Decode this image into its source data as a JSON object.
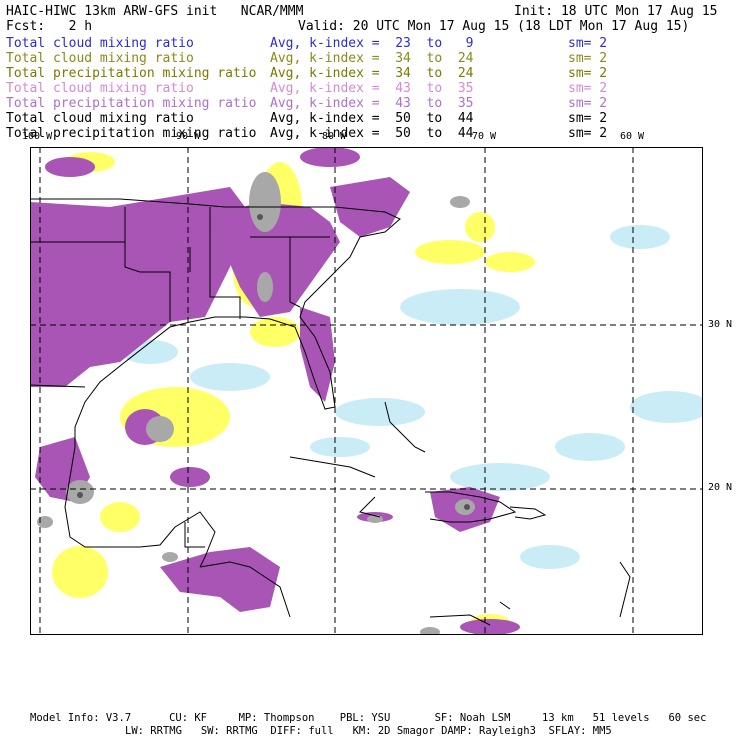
{
  "header": {
    "title": "HAIC-HIWC 13km ARW-GFS init   NCAR/MMM",
    "init": "Init: 18 UTC Mon 17 Aug 15",
    "fcst": "Fcst:   2 h",
    "valid": "Valid: 20 UTC Mon 17 Aug 15 (18 LDT Mon 17 Aug 15)"
  },
  "legend": [
    {
      "field": "Total cloud mixing ratio",
      "index": "Avg, k-index =  23  to   9",
      "sm": "sm= 2",
      "color": "#2c2ccc"
    },
    {
      "field": "Total cloud mixing ratio",
      "index": "Avg, k-index =  34  to  24",
      "sm": "sm= 2",
      "color": "#8a8a1a"
    },
    {
      "field": "Total precipitation mixing ratio",
      "index": "Avg, k-index =  34  to  24",
      "sm": "sm= 2",
      "color": "#7a7a00"
    },
    {
      "field": "Total cloud mixing ratio",
      "index": "Avg, k-index =  43  to  35",
      "sm": "sm= 2",
      "color": "#d68ad6"
    },
    {
      "field": "Total precipitation mixing ratio",
      "index": "Avg, k-index =  43  to  35",
      "sm": "sm= 2",
      "color": "#b070c8"
    },
    {
      "field": "Total cloud mixing ratio",
      "index": "Avg, k-index =  50  to  44",
      "sm": "sm= 2",
      "color": "#000000"
    },
    {
      "field": "Total precipitation mixing ratio",
      "index": "Avg, k-index =  50  to  44",
      "sm": "sm= 2",
      "color": "#000000"
    }
  ],
  "map": {
    "lon_labels": [
      "100 W",
      "90 W",
      "80 W",
      "70 W",
      "60 W"
    ],
    "lat_labels": [
      "30 N",
      "20 N"
    ],
    "colors": {
      "cyan": "#c9ecf7",
      "yellow": "#ffff66",
      "purple": "#a855b5",
      "gray": "#a8a8a8",
      "dark": "#555555"
    }
  },
  "footer": {
    "line1": "Model Info: V3.7      CU: KF     MP: Thompson    PBL: YSU       SF: Noah LSM     13 km   51 levels   60 sec",
    "line2": "LW: RRTMG   SW: RRTMG  DIFF: full   KM: 2D Smagor DAMP: Rayleigh3  SFLAY: MM5"
  }
}
